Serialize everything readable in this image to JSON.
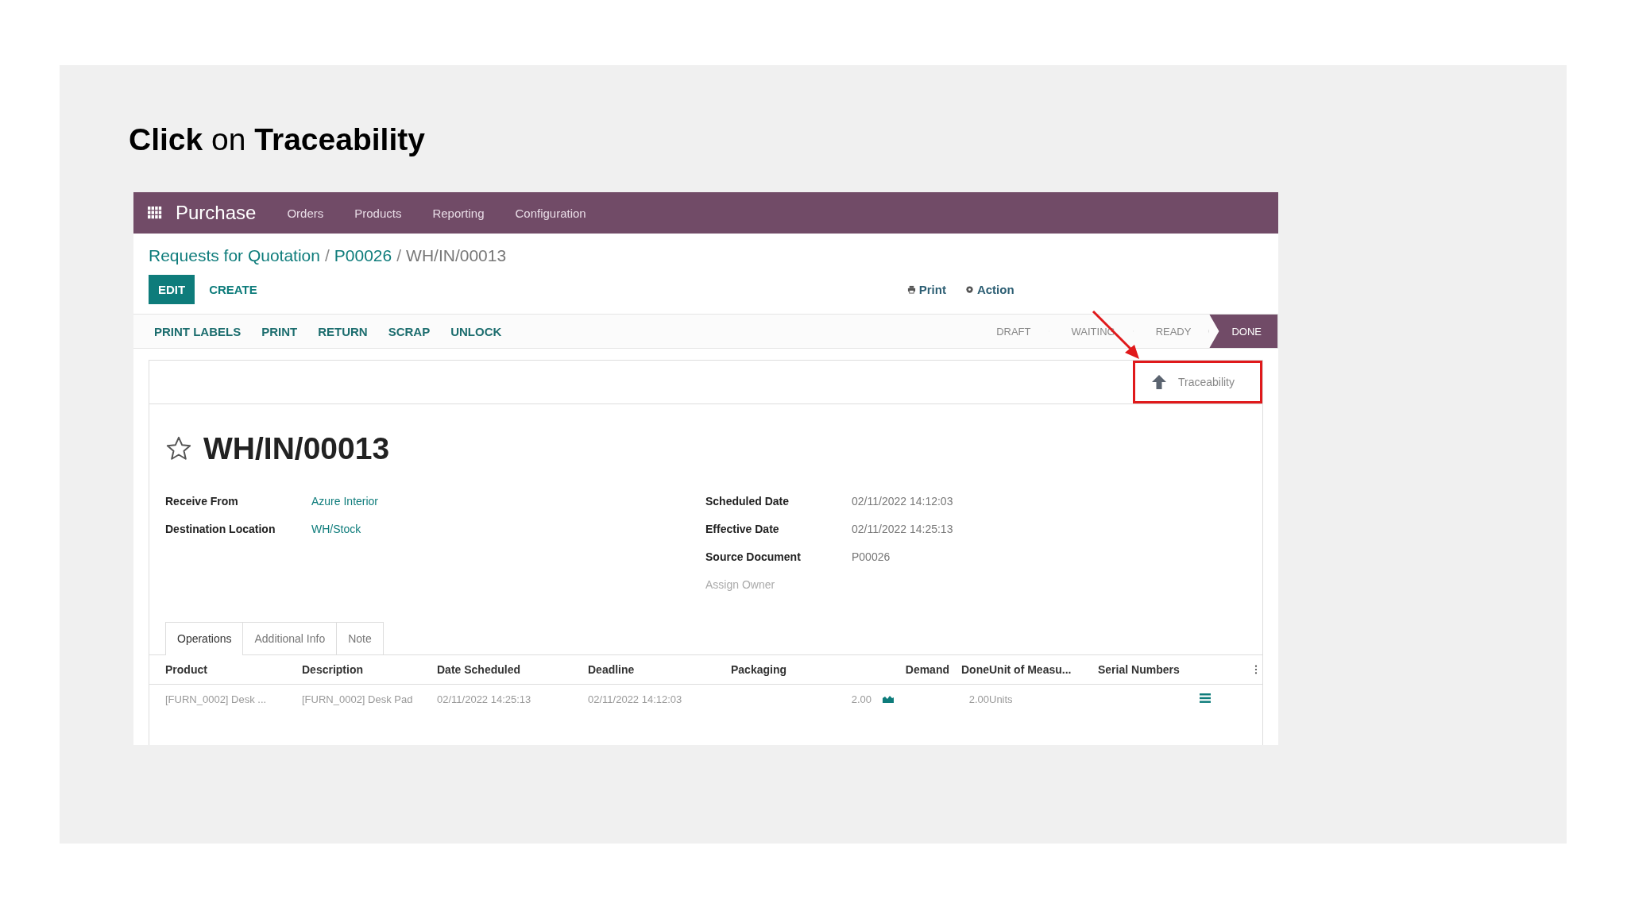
{
  "slide_title": "**Click** on **Traceability**",
  "navbar": {
    "app": "Purchase",
    "menu": [
      "Orders",
      "Products",
      "Reporting",
      "Configuration"
    ]
  },
  "breadcrumbs": [
    {
      "label": "Requests for Quotation",
      "link": true
    },
    {
      "separator": "/",
      "label": "P00026",
      "link": true
    },
    {
      "separator": "/",
      "label": "WH/IN/00013",
      "link": false
    }
  ],
  "buttons": [
    {
      "label": "EDIT",
      "primary": true
    },
    {
      "label": "CREATE",
      "primary": false
    }
  ],
  "actions": [
    {
      "label": "Print",
      "kind": "print"
    },
    {
      "label": "Action",
      "kind": "gear"
    }
  ],
  "header_buttons": [
    "PRINT LABELS",
    "PRINT",
    "RETURN",
    "SCRAP",
    "UNLOCK"
  ],
  "stages": [
    {
      "label": "DRAFT",
      "selected": false
    },
    {
      "label": "WAITING",
      "selected": false
    },
    {
      "label": "READY",
      "selected": false
    },
    {
      "label": "DONE",
      "selected": true
    }
  ],
  "smart_button": {
    "label": "Traceability",
    "highlighted": true
  },
  "record": {
    "title": "WH/IN/00013",
    "starred": false
  },
  "fields_left": [
    {
      "label": "Receive From",
      "value": "Azure Interior"
    },
    {
      "label": "Destination Location",
      "value": "WH/Stock"
    }
  ],
  "fields_right": [
    {
      "label": "Scheduled Date",
      "value": "02/11/2022 14:12:03",
      "muted": false
    },
    {
      "label": "Effective Date",
      "value": "02/11/2022 14:25:13",
      "muted": false
    },
    {
      "label": "Source Document",
      "value": "P00026",
      "muted": false
    },
    {
      "label": "Assign Owner",
      "muted": true
    }
  ],
  "tabs": [
    {
      "label": "Operations",
      "selected": true
    },
    {
      "label": "Additional Info",
      "selected": false
    },
    {
      "label": "Note",
      "selected": false
    }
  ],
  "table": {
    "columns": [
      "Product",
      "Description",
      "Date Scheduled",
      "Deadline",
      "Packaging",
      "Demand",
      "Done",
      "Unit of Measu...",
      "Serial Numbers"
    ],
    "rows": [
      {
        "product": "[FURN_0002] Desk ...",
        "description": "[FURN_0002] Desk Pad",
        "date_scheduled": "02/11/2022 14:25:13",
        "deadline": "02/11/2022 14:12:03",
        "demand": "2.00",
        "done": "2.00",
        "uom": "Units"
      }
    ]
  }
}
